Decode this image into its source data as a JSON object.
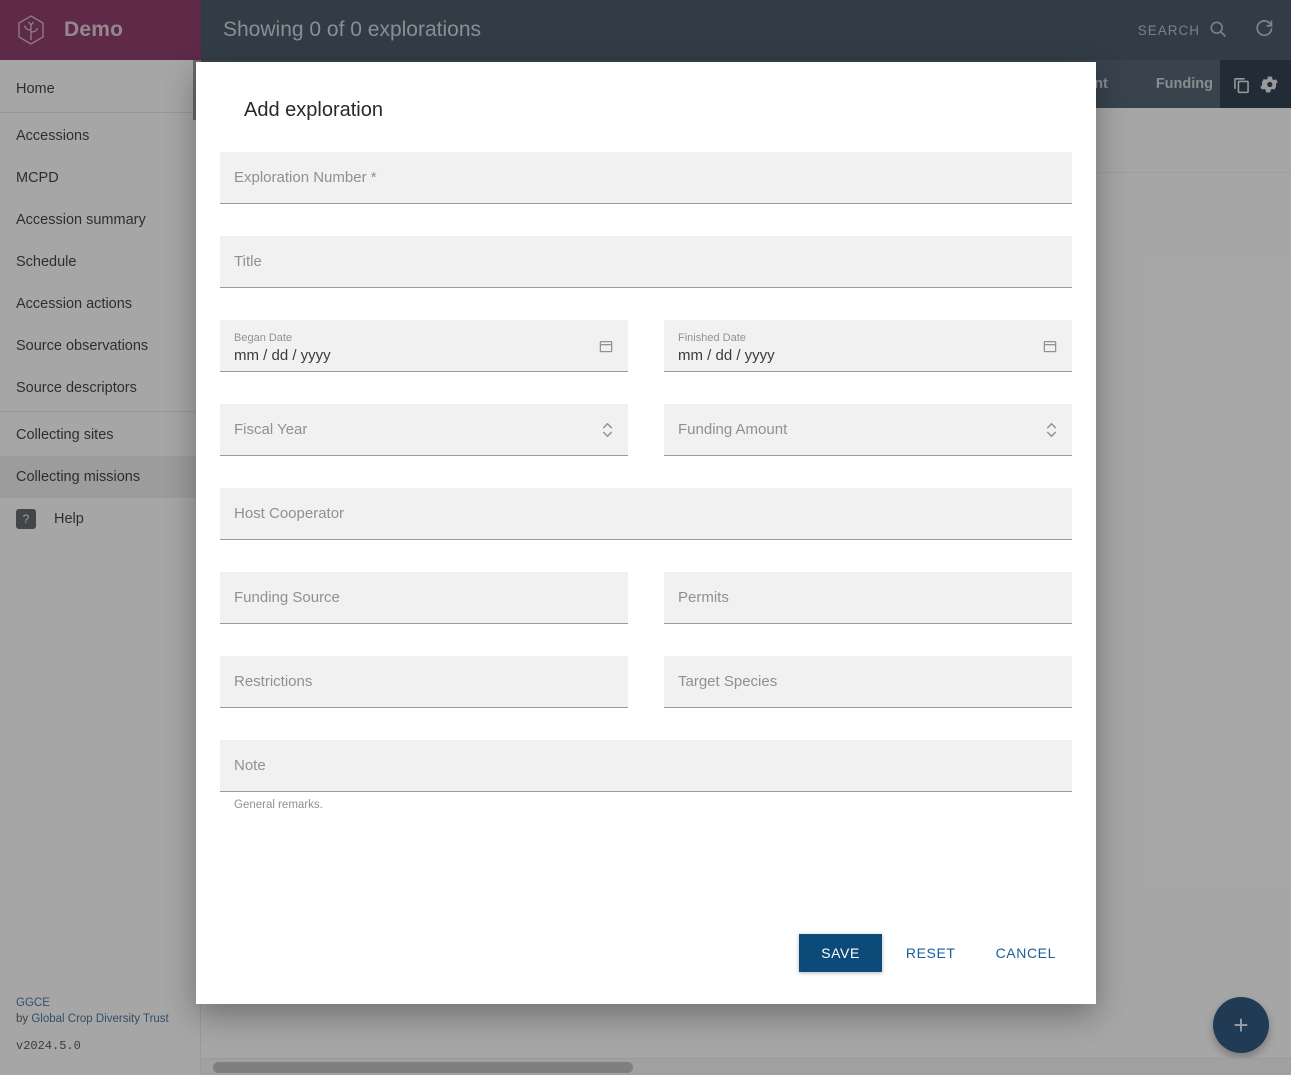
{
  "brand": {
    "title": "Demo",
    "logo_icon": "hexagon-sprout-logo-icon"
  },
  "topbar": {
    "title": "Showing 0 of 0 explorations",
    "search_label": "SEARCH",
    "search_icon": "search-icon",
    "refresh_icon": "refresh-icon"
  },
  "sidebar": {
    "items": [
      {
        "label": "Home",
        "selected": false
      },
      {
        "label": "Accessions",
        "selected": false
      },
      {
        "label": "MCPD",
        "selected": false
      },
      {
        "label": "Accession summary",
        "selected": false
      },
      {
        "label": "Schedule",
        "selected": false
      },
      {
        "label": "Accession actions",
        "selected": false
      },
      {
        "label": "Source observations",
        "selected": false
      },
      {
        "label": "Source descriptors",
        "selected": false
      },
      {
        "label": "Collecting sites",
        "selected": false
      },
      {
        "label": "Collecting missions",
        "selected": true
      }
    ],
    "help": {
      "label": "Help",
      "glyph": "?",
      "icon": "help-icon"
    },
    "footer": {
      "product": "GGCE",
      "by_prefix": "by ",
      "org": "Global Crop Diversity Trust",
      "version": "v2024.5.0"
    }
  },
  "table": {
    "columns": [
      "Amount",
      "Funding"
    ],
    "copy_icon": "copy-icon",
    "settings_icon": "gear-icon"
  },
  "fab": {
    "label": "+",
    "icon": "plus-icon"
  },
  "dialog": {
    "title": "Add exploration",
    "fields": {
      "exploration_number": {
        "label": "Exploration Number *",
        "value": "",
        "placeholder": "Exploration Number *"
      },
      "title": {
        "label": "Title",
        "value": "",
        "placeholder": "Title"
      },
      "began_date": {
        "label": "Began Date",
        "value": "mm / dd / yyyy",
        "icon": "calendar-icon"
      },
      "finished_date": {
        "label": "Finished Date",
        "value": "mm / dd / yyyy",
        "icon": "calendar-icon"
      },
      "fiscal_year": {
        "label": "Fiscal Year",
        "value": "",
        "icon": "stepper-icon"
      },
      "funding_amount": {
        "label": "Funding Amount",
        "value": "",
        "icon": "stepper-icon"
      },
      "host_cooperator": {
        "label": "Host Cooperator",
        "value": ""
      },
      "funding_source": {
        "label": "Funding Source",
        "value": ""
      },
      "permits": {
        "label": "Permits",
        "value": ""
      },
      "restrictions": {
        "label": "Restrictions",
        "value": ""
      },
      "target_species": {
        "label": "Target Species",
        "value": ""
      },
      "note": {
        "label": "Note",
        "value": "",
        "helper": "General remarks."
      }
    },
    "actions": {
      "save": "SAVE",
      "reset": "RESET",
      "cancel": "CANCEL"
    }
  },
  "colors": {
    "brand": "#7b1b52",
    "appbar": "#2c3e50",
    "table_header": "#37495c",
    "table_tools": "#0d2033",
    "primary": "#0c4a7a",
    "fab": "#0c3b66"
  }
}
